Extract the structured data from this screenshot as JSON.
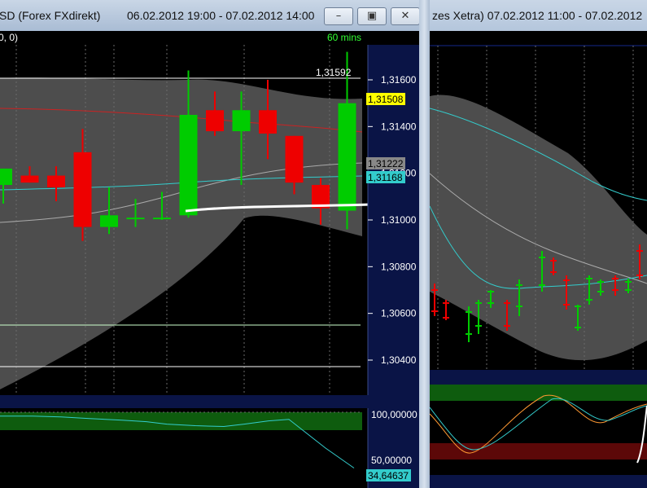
{
  "left_window": {
    "title_prefix": "SD (Forex FXdirekt)",
    "title_range": "06.02.2012 19:00 - 07.02.2012 14:00",
    "params_label": "0, 0)",
    "interval_label": "60 mins",
    "buttons": {
      "minimize": "–",
      "restore": "▣",
      "close": "✕"
    },
    "price_axis": {
      "ticks": [
        "1,31600",
        "1,31400",
        "1,31200",
        "1,31000",
        "1,30800",
        "1,30600",
        "1,30400"
      ],
      "tick_values": [
        1.316,
        1.314,
        1.312,
        1.31,
        1.308,
        1.306,
        1.304
      ]
    },
    "price_labels": {
      "high": "1,31592",
      "last": "1,31508",
      "ma_gray": "1,31222",
      "ma_cyan": "1,31168"
    },
    "oscillator_axis": {
      "ticks": [
        "100,00000",
        "50,00000"
      ],
      "last": "34,64637"
    },
    "colors": {
      "up": "#00cc00",
      "down": "#ee0000",
      "cyan": "#33cccc",
      "highlight": "#ffff00",
      "band": "#505050"
    }
  },
  "right_window": {
    "title": "zes Xetra) 07.02.2012 11:00 - 07.02.2012"
  },
  "chart_data": {
    "type": "candlestick",
    "price_ylim": [
      1.3025,
      1.3175
    ],
    "candles": [
      {
        "o": 1.3115,
        "h": 1.3122,
        "l": 1.3107,
        "c": 1.3122
      },
      {
        "o": 1.3119,
        "h": 1.3123,
        "l": 1.3116,
        "c": 1.3116
      },
      {
        "o": 1.3119,
        "h": 1.3123,
        "l": 1.3108,
        "c": 1.3114
      },
      {
        "o": 1.3129,
        "h": 1.3139,
        "l": 1.3091,
        "c": 1.3097
      },
      {
        "o": 1.3097,
        "h": 1.3114,
        "l": 1.3094,
        "c": 1.3102
      },
      {
        "o": 1.3101,
        "h": 1.3109,
        "l": 1.3097,
        "c": 1.3101
      },
      {
        "o": 1.3101,
        "h": 1.3112,
        "l": 1.31,
        "c": 1.3101
      },
      {
        "o": 1.3102,
        "h": 1.3164,
        "l": 1.3101,
        "c": 1.3145
      },
      {
        "o": 1.3147,
        "h": 1.3155,
        "l": 1.3136,
        "c": 1.3138
      },
      {
        "o": 1.3138,
        "h": 1.3155,
        "l": 1.3115,
        "c": 1.3147
      },
      {
        "o": 1.3147,
        "h": 1.316,
        "l": 1.3126,
        "c": 1.3137
      },
      {
        "o": 1.3136,
        "h": 1.3136,
        "l": 1.3111,
        "c": 1.3116
      },
      {
        "o": 1.3115,
        "h": 1.3118,
        "l": 1.3098,
        "c": 1.3105
      },
      {
        "o": 1.3104,
        "h": 1.3172,
        "l": 1.3096,
        "c": 1.315
      }
    ],
    "horizontal_lines": [
      1.3159,
      1.3051,
      1.3033
    ],
    "oscillator": {
      "ylim": [
        10,
        110
      ],
      "values": [
        100,
        100,
        99,
        97,
        95,
        93,
        90,
        88,
        87,
        90,
        94,
        96,
        60,
        35
      ]
    }
  }
}
